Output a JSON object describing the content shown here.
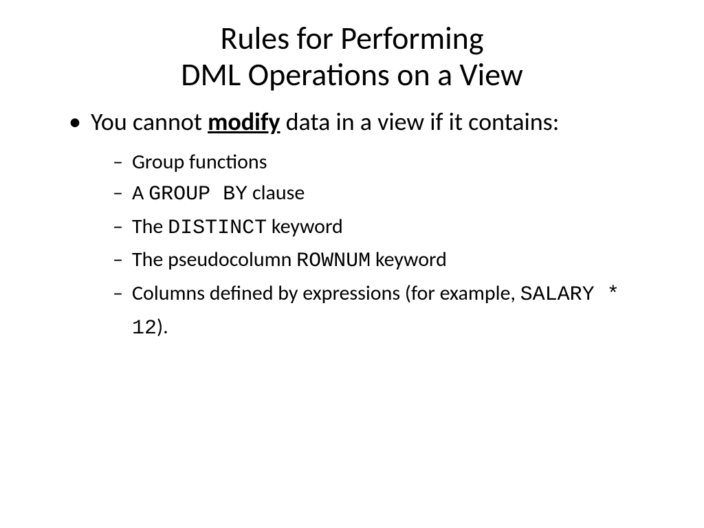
{
  "title": {
    "line1": "Rules for Performing",
    "line2": "DML Operations on a View"
  },
  "main_item": {
    "prefix": "You cannot ",
    "emphasis": "modify",
    "suffix": " data in a view if it contains:"
  },
  "sub_items": [
    {
      "text": "Group functions"
    },
    {
      "prefix": "A ",
      "code": "GROUP BY",
      "suffix": " clause"
    },
    {
      "prefix": "The ",
      "code": "DISTINCT",
      "suffix": " keyword"
    },
    {
      "prefix": "The pseudocolumn ",
      "code": "ROWNUM",
      "suffix": " keyword"
    },
    {
      "prefix": "Columns defined by expressions (for example, ",
      "code": "SALARY * 12",
      "suffix": ")."
    }
  ]
}
